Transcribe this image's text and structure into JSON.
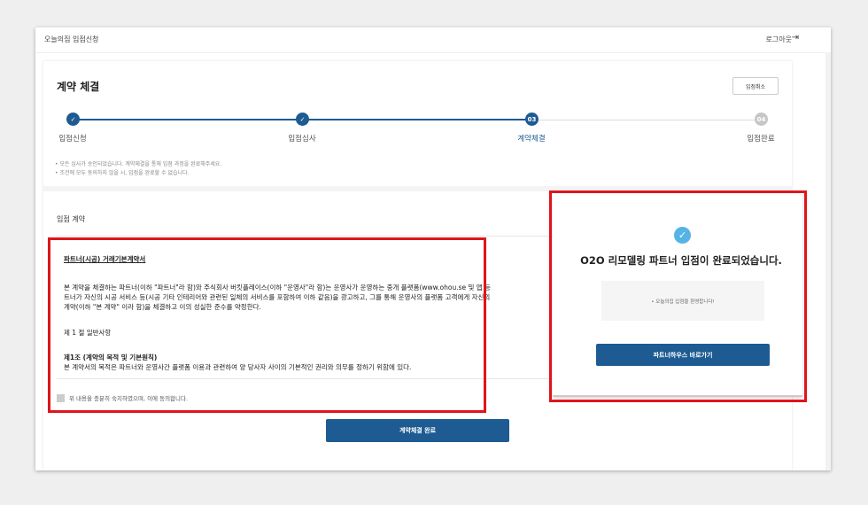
{
  "header": {
    "brand": "오늘의집 입점신청",
    "logout": "로그아웃"
  },
  "page": {
    "title": "계약 체결",
    "cancel": "입점취소",
    "steps": [
      {
        "num": "✓",
        "label": "입점신청",
        "state": "done"
      },
      {
        "num": "✓",
        "label": "입점심사",
        "state": "done"
      },
      {
        "num": "03",
        "label": "계약체결",
        "state": "active"
      },
      {
        "num": "04",
        "label": "입점완료",
        "state": "pending"
      }
    ],
    "notes": [
      "• 모든 심사가 승인되었습니다. 계약체결을 통해 입점 과정을 완료해주세요.",
      "• 조건에 모두 동의하지 않을 시, 입점을 완료할 수 없습니다."
    ]
  },
  "contract": {
    "section_title": "입점 계약",
    "heading": "파트너(시공) 거래기본계약서",
    "body": [
      "본 계약을 체결하는 파트너(이하 \"파트너\"라 함)와 주식회사 버킷플레이스(이하 \"운영사\"라 함)는 운영사가 운영하는 중개 플랫폼(www.ohou.se 및 앱 등",
      "트너가 자신의 시공 서비스 등(시공 기타 인테리어와 관련된 일체의 서비스를 포함하여 이하 같음)을 광고하고, 그를 통해 운영사의 플랫폼 고객에게 자신의",
      "계약(이하 \"본 계약\" 이라 함)을 체결하고 이의 성실한 준수를 약정한다."
    ],
    "chapter": "제 1 절   일반사항",
    "article_title": "제1조 (계약의 목적 및 기본원칙)",
    "article_body": "본 계약서의 목적은 파트너와 운영사간 플랫폼 이용과 관련하여 양 당사자 사이의 기본적인 권리와 의무를 정하기 위함에 있다.",
    "agree": "위 내용을 충분히 숙지하였으며, 이에 동의합니다.",
    "submit": "계약체결 완료"
  },
  "modal": {
    "title": "O2O 리모델링 파트너 입점이 완료되었습니다.",
    "message": "• 오늘의집 입점을 환영합니다!",
    "button": "파트너하우스 바로가기"
  },
  "colors": {
    "accent": "#1e5b93",
    "highlight": "#e0141b",
    "check": "#55b3e6"
  },
  "icons": {
    "logout": "logout-icon",
    "check": "check-circle-icon"
  }
}
